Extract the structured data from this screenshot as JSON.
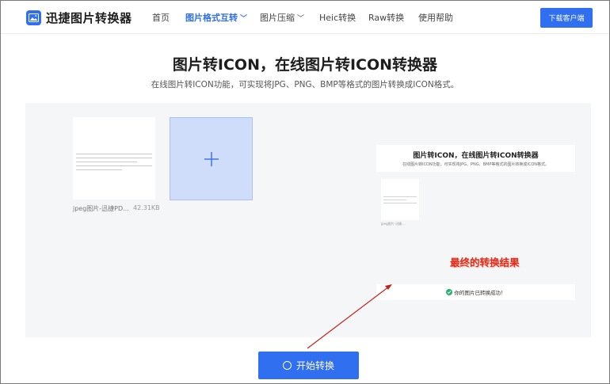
{
  "header": {
    "logo_text": "迅捷图片转换器",
    "nav": [
      {
        "label": "首页"
      },
      {
        "label": "图片格式互转",
        "active": true
      },
      {
        "label": "图片压缩"
      },
      {
        "label": "Heic转换"
      },
      {
        "label": "Raw转换"
      },
      {
        "label": "使用帮助"
      }
    ],
    "download_label": "下载客户端"
  },
  "hero": {
    "title": "图片转ICON，在线图片转ICON转换器",
    "subtitle": "在线图片转ICON功能，可实现将JPG、PNG、BMP等格式的图片转换成ICON格式。"
  },
  "upload": {
    "file_name": "jpeg图片-迅捷PD...",
    "file_size": "42.31KB"
  },
  "result": {
    "title": "图片转ICON，在线图片转ICON转换器",
    "subtitle": "在线图片转ICON功能，可实现将JPG、PNG、BMP等格式的图片转换成ICON格式。",
    "file_label": "jpeg图片-迅捷...",
    "annotation": "最终的转换结果",
    "success_text": "你的图片已转换成功！"
  },
  "start_button": {
    "label": "开始转换"
  },
  "colors": {
    "accent": "#2f6ff0",
    "annotation": "#e02d1c",
    "success": "#23b26d",
    "upload_box": "#cfdcfa"
  },
  "icons": {
    "logo": "image-icon",
    "nav_dropdown": "chevron-down-icon",
    "add": "plus-icon",
    "success": "check-circle-icon",
    "start": "spinner-icon"
  }
}
